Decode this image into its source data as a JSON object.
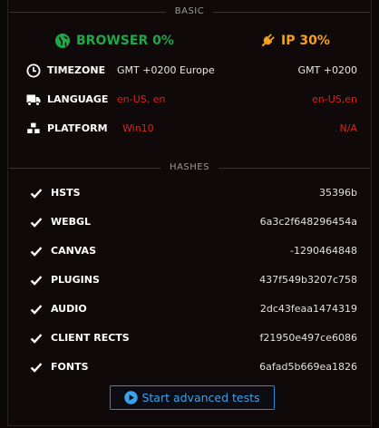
{
  "sections": {
    "basic_label": "BASIC",
    "hashes_label": "HASHES"
  },
  "scores": {
    "browser": {
      "label": "BROWSER 0%",
      "icon": "globe-icon",
      "color": "#1fa84a"
    },
    "ip": {
      "label": "IP 30%",
      "icon": "plug-icon",
      "color": "#f7a11a"
    }
  },
  "info_rows": [
    {
      "name": "TIMEZONE",
      "icon": "clock-icon",
      "value1": "GMT +0200  Europe",
      "value2": "GMT +0200",
      "status": "match"
    },
    {
      "name": "LANGUAGE",
      "icon": "truck-icon",
      "value1": "en-US, en",
      "value2": "en-US,en",
      "status": "mismatch"
    },
    {
      "name": "PLATFORM",
      "icon": "cubes-icon",
      "value1": "Win10",
      "value2": "N/A",
      "status": "mismatch"
    }
  ],
  "hashes": [
    {
      "name": "HSTS",
      "value": "35396b"
    },
    {
      "name": "WEBGL",
      "value": "6a3c2f648296454a"
    },
    {
      "name": "CANVAS",
      "value": "-1290464848"
    },
    {
      "name": "PLUGINS",
      "value": "437f549b3207c758"
    },
    {
      "name": "AUDIO",
      "value": "2dc43feaa1474319"
    },
    {
      "name": "CLIENT RECTS",
      "value": "f21950e497ce6086"
    },
    {
      "name": "FONTS",
      "value": "6afad5b669ea1826"
    }
  ],
  "actions": {
    "advanced_label": "Start advanced tests",
    "advanced_icon": "play-circle-icon"
  },
  "colors": {
    "mismatch": "#e0201c",
    "match": "#e8e8e8",
    "accent_blue": "#39a3ee"
  }
}
